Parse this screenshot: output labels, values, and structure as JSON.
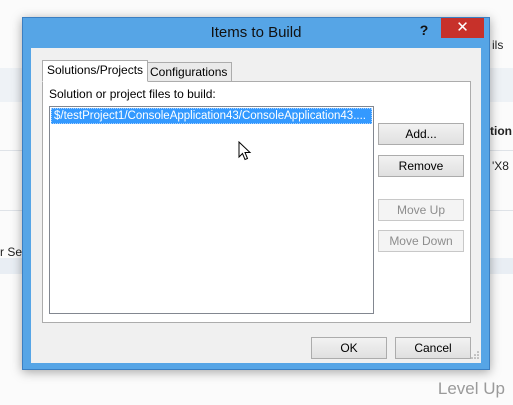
{
  "background": {
    "left_text": "r Se",
    "right_top_text": "ils",
    "right_mid_text": "tion",
    "right_low_text": "'X8"
  },
  "dialog": {
    "title": "Items to Build",
    "help_label": "?",
    "close_label": "✕",
    "tabs": [
      {
        "label": "Solutions/Projects",
        "active": true
      },
      {
        "label": "Configurations",
        "active": false
      }
    ],
    "panel_label": "Solution or project files to build:",
    "list_items": [
      "$/testProject1/ConsoleApplication43/ConsoleApplication43...."
    ],
    "buttons": {
      "add": "Add...",
      "remove": "Remove",
      "move_up": "Move Up",
      "move_down": "Move Down",
      "ok": "OK",
      "cancel": "Cancel"
    },
    "grip_icon": "resize-grip-icon"
  },
  "watermark": "Level Up",
  "colors": {
    "titlebar": "#56a5e6",
    "close_button": "#c7312a",
    "selection": "#3399ff"
  }
}
